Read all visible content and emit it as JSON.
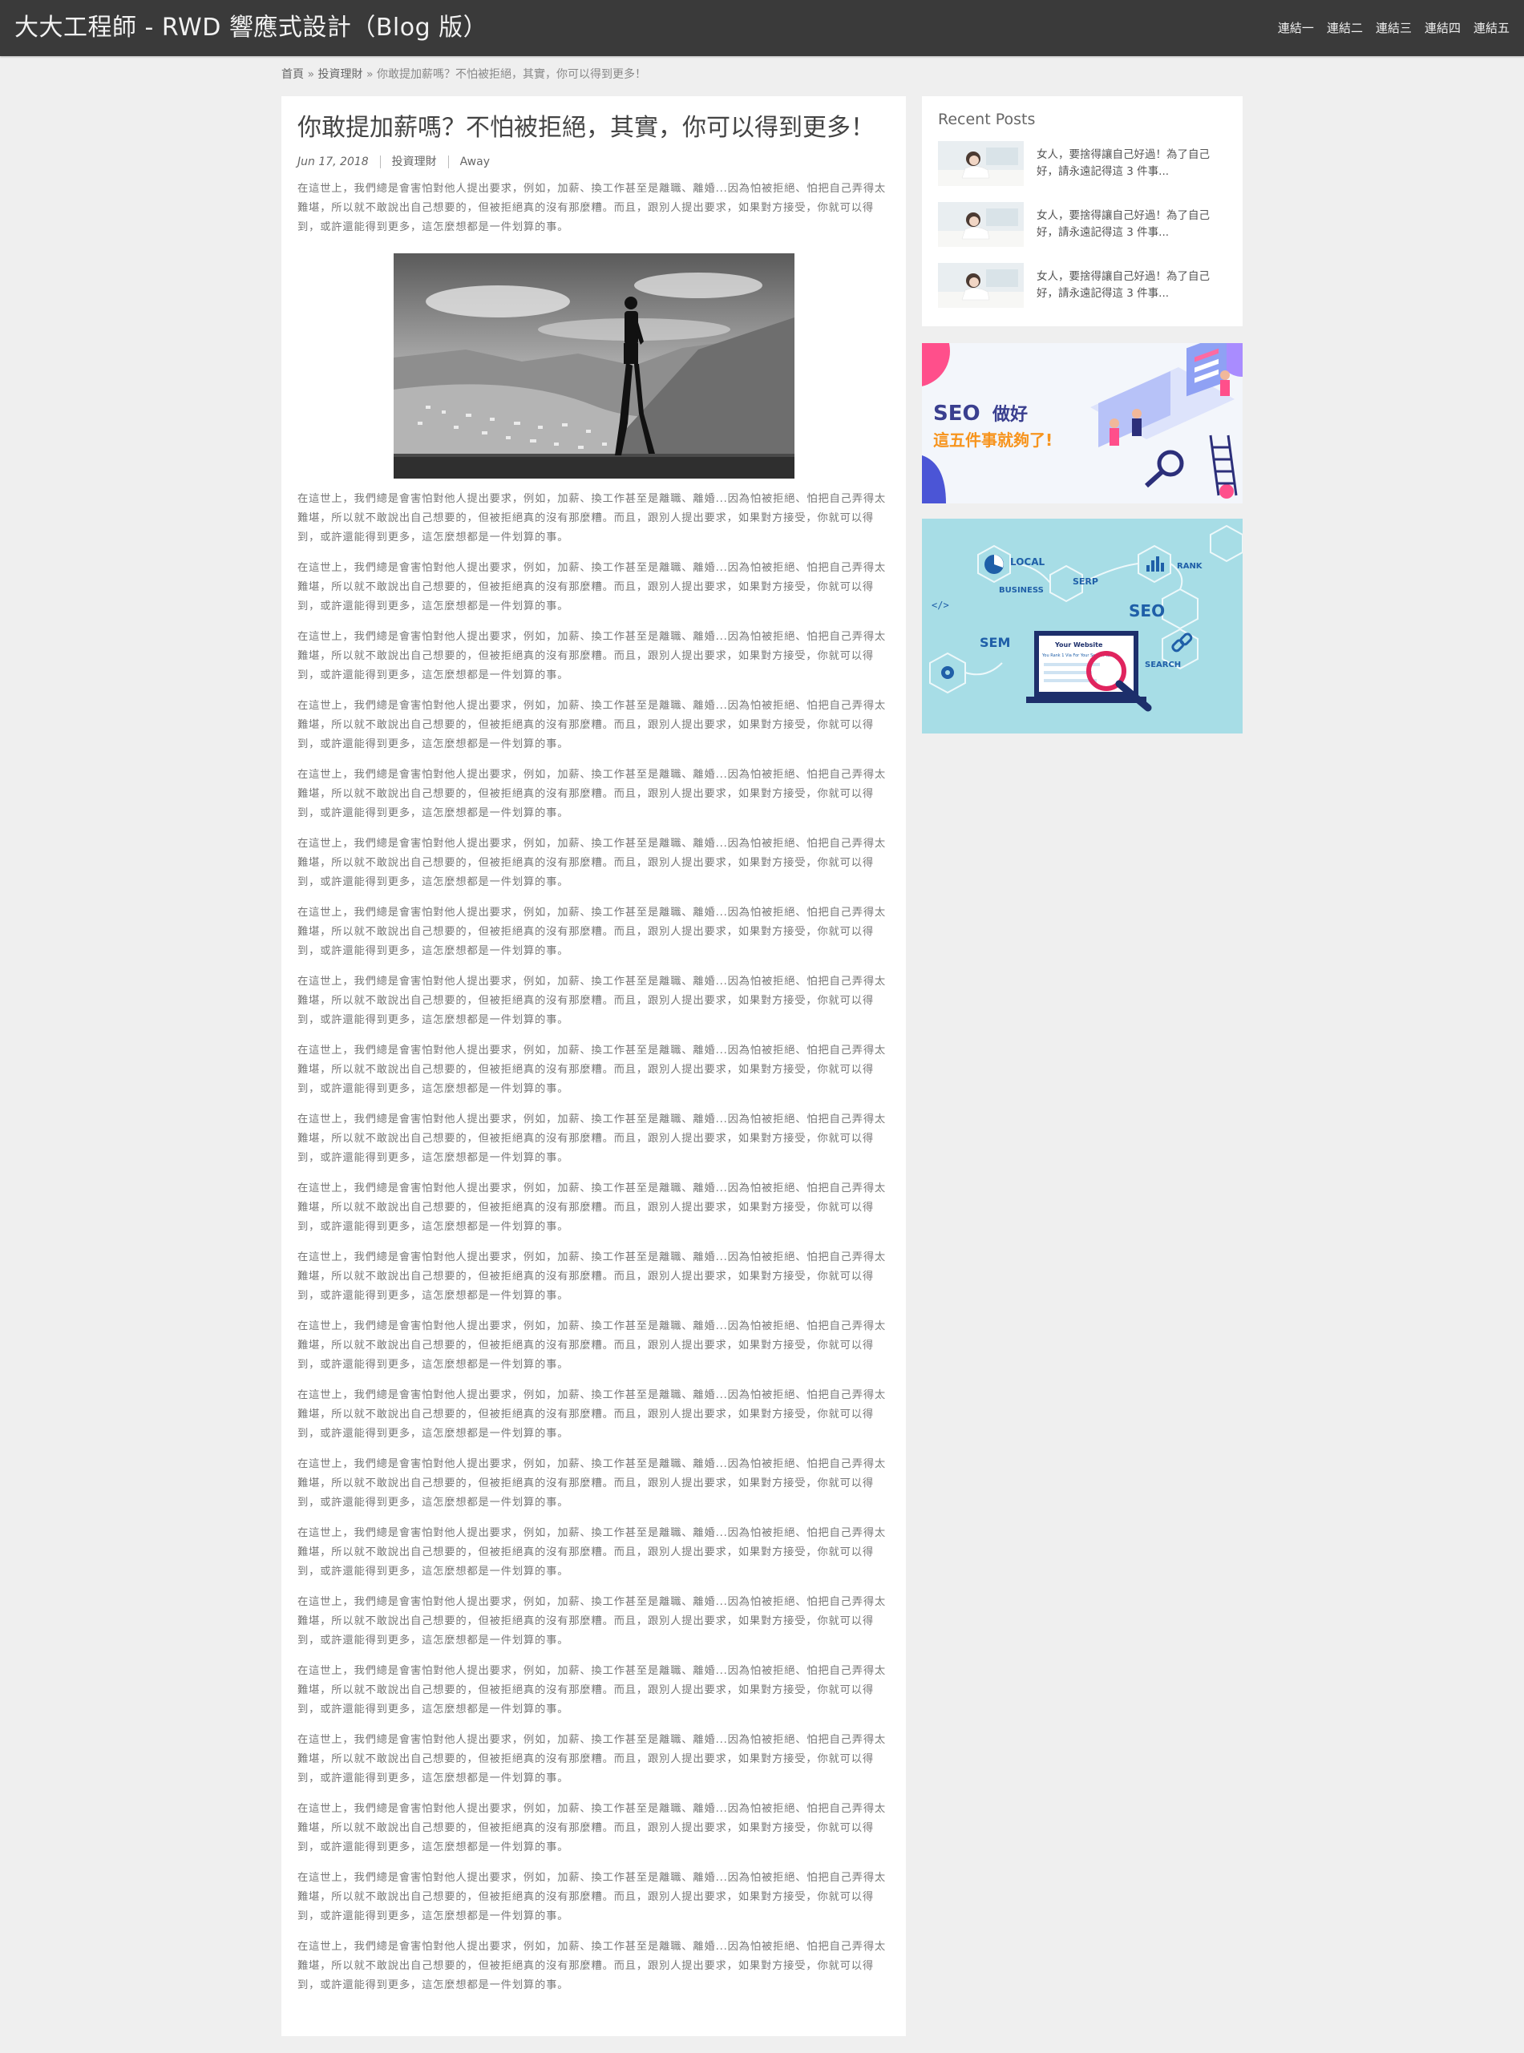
{
  "header": {
    "site_title": "大大工程師 - RWD 響應式設計（Blog 版）",
    "nav": [
      "連結一",
      "連結二",
      "連結三",
      "連結四",
      "連結五"
    ]
  },
  "breadcrumb": {
    "home": "首頁",
    "separator": "»",
    "category": "投資理財",
    "current": "你敢提加薪嗎？不怕被拒絕，其實，你可以得到更多！"
  },
  "article": {
    "title": "你敢提加薪嗎？不怕被拒絕，其實，你可以得到更多！",
    "date": "Jun 17, 2018",
    "category": "投資理財",
    "author": "Away",
    "paragraph": "在這世上，我們總是會害怕對他人提出要求，例如，加薪、換工作甚至是離職、離婚...因為怕被拒絕、怕把自己弄得太難堪，所以就不敢說出自己想要的，但被拒絕真的沒有那麼糟。而且，跟別人提出要求，如果對方接受，你就可以得到，或許還能得到更多，這怎麼想都是一件划算的事。",
    "repeat_count": 22
  },
  "sidebar": {
    "recent_heading": "Recent Posts",
    "recent_posts": [
      "女人，要捨得讓自己好過！為了自己好，請永遠記得這 3 件事...",
      "女人，要捨得讓自己好過！為了自己好，請永遠記得這 3 件事...",
      "女人，要捨得讓自己好過！為了自己好，請永遠記得這 3 件事..."
    ],
    "ad1": {
      "line1_a": "SEO",
      "line1_b": "做好",
      "line2": "這五件事就夠了!"
    },
    "ad2": {
      "labels": [
        "LOCAL",
        "RANK",
        "BUSINESS",
        "SERP",
        "SEO",
        "SEM",
        "SEARCH"
      ],
      "screen_title": "Your Website",
      "screen_text": "You Rank 1 Via For Your Search Terms"
    }
  },
  "colors": {
    "topbar": "#3a3a3a",
    "page_bg": "#efefef",
    "seo_orange": "#f7941d",
    "seo_navy": "#3a3f8f",
    "ad2_bg": "#a7dde6"
  }
}
